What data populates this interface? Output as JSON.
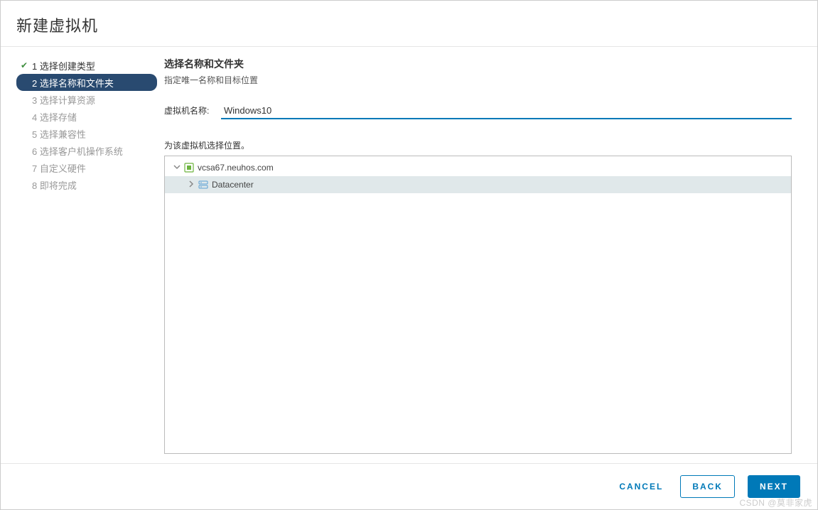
{
  "dialog": {
    "title": "新建虚拟机"
  },
  "steps": [
    {
      "num": "1",
      "label": "1 选择创建类型",
      "state": "completed"
    },
    {
      "num": "2",
      "label": "2 选择名称和文件夹",
      "state": "active"
    },
    {
      "num": "3",
      "label": "3 选择计算资源",
      "state": "pending"
    },
    {
      "num": "4",
      "label": "4 选择存储",
      "state": "pending"
    },
    {
      "num": "5",
      "label": "5 选择兼容性",
      "state": "pending"
    },
    {
      "num": "6",
      "label": "6 选择客户机操作系统",
      "state": "pending"
    },
    {
      "num": "7",
      "label": "7 自定义硬件",
      "state": "pending"
    },
    {
      "num": "8",
      "label": "8 即将完成",
      "state": "pending"
    }
  ],
  "main": {
    "section_title": "选择名称和文件夹",
    "section_sub": "指定唯一名称和目标位置",
    "vm_name_label": "虚拟机名称:",
    "vm_name_value": "Windows10",
    "location_label": "为该虚拟机选择位置。",
    "tree": {
      "root": {
        "label": "vcsa67.neuhos.com",
        "expanded": true
      },
      "child": {
        "label": "Datacenter",
        "expanded": false,
        "selected": true
      }
    }
  },
  "footer": {
    "cancel": "CANCEL",
    "back": "BACK",
    "next": "NEXT"
  },
  "watermark": "CSDN @莫非家虎"
}
